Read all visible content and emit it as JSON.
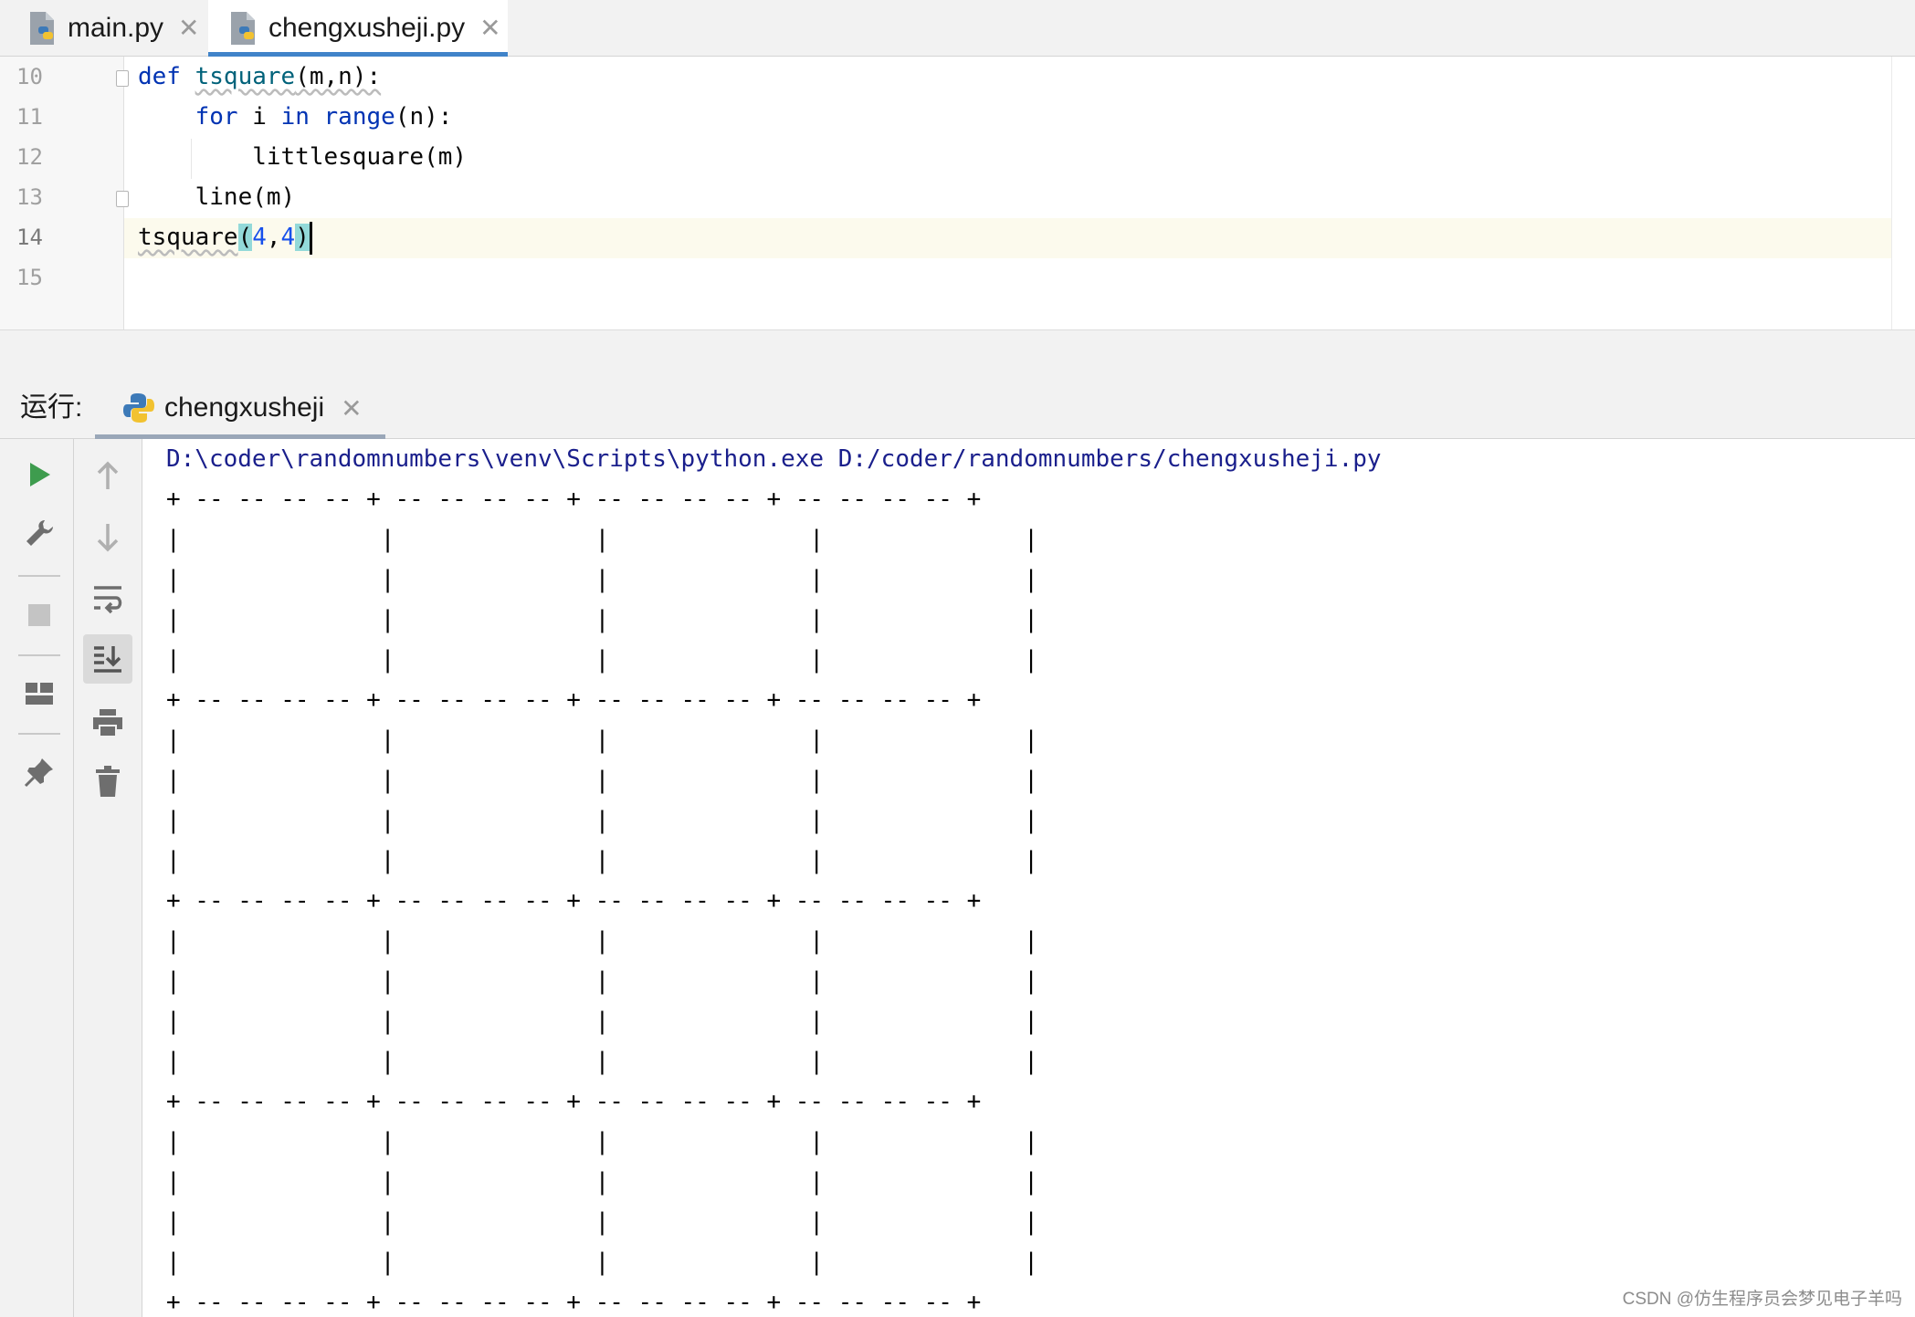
{
  "tabs": [
    {
      "label": "main.py",
      "active": false,
      "icon": "python-file-icon"
    },
    {
      "label": "chengxusheji.py",
      "active": true,
      "icon": "python-file-icon"
    }
  ],
  "editor": {
    "line_numbers": [
      "10",
      "11",
      "12",
      "13",
      "14",
      "15"
    ],
    "current_line": "14",
    "code": {
      "l10": {
        "kw": "def",
        "fn": "tsquare",
        "rest": "(m,n):"
      },
      "l11": {
        "indent": "    ",
        "kw1": "for",
        "mid": " i ",
        "kw2": "in",
        "fn": " range",
        "rest": "(n):"
      },
      "l12": {
        "text": "        littlesquare(m)"
      },
      "l13": {
        "text": "    line(m)"
      },
      "l14": {
        "fn": "tsquare",
        "open": "(",
        "a": "4",
        "comma": ",",
        "b": "4",
        "close": ")"
      }
    }
  },
  "run_panel": {
    "label": "运行:",
    "tab_label": "chengxusheji",
    "console": {
      "command": "D:\\coder\\randomnumbers\\venv\\Scripts\\python.exe D:/coder/randomnumbers/chengxusheji.py",
      "border_row": "+ -- -- -- -- + -- -- -- -- + -- -- -- -- + -- -- -- -- +",
      "pipe_row": "|              |              |              |              |"
    }
  },
  "toolbar_left": [
    "run-icon",
    "wrench-icon",
    "stop-icon",
    "layout-icon",
    "pin-icon"
  ],
  "toolbar_right": [
    "arrow-up-icon",
    "arrow-down-icon",
    "soft-wrap-icon",
    "scroll-to-end-icon",
    "print-icon",
    "trash-icon"
  ],
  "colors": {
    "keyword": "#0033b3",
    "function": "#00627a",
    "number": "#1750eb",
    "accent": "#4083c9",
    "run_green": "#3e9c4e"
  },
  "watermark": "CSDN @仿生程序员会梦见电子羊吗"
}
